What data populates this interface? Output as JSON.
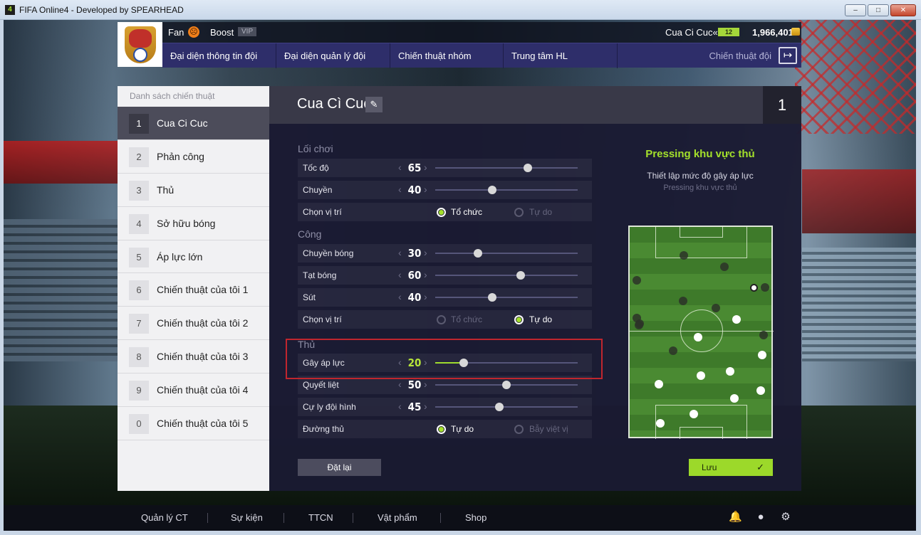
{
  "window": {
    "title": "FIFA Online4 - Developed by SPEARHEAD",
    "app_icon": "4",
    "min_label": "–",
    "max_label": "□",
    "close_label": "✕"
  },
  "header": {
    "fan_label": "Fan",
    "boost_label": "Boost",
    "vip_label": "VIP",
    "user_name": "Cua Ci Cuc«",
    "level": "12",
    "coins": "1,966,401"
  },
  "nav": {
    "items": [
      {
        "label": "Đại diện thông tin đội"
      },
      {
        "label": "Đại diện quản lý đội"
      },
      {
        "label": "Chiến thuật nhóm"
      },
      {
        "label": "Trung tâm HL"
      }
    ],
    "right_label": "Chiến thuật đội",
    "exit_icon": "exit-icon"
  },
  "sidebar": {
    "title": "Danh sách chiến thuật",
    "items": [
      {
        "num": "1",
        "label": "Cua Ci Cuc",
        "active": true
      },
      {
        "num": "2",
        "label": "Phản công"
      },
      {
        "num": "3",
        "label": "Thủ"
      },
      {
        "num": "4",
        "label": "Sở hữu bóng"
      },
      {
        "num": "5",
        "label": "Áp lực lớn"
      },
      {
        "num": "6",
        "label": "Chiến thuật của tôi 1"
      },
      {
        "num": "7",
        "label": "Chiến thuật của tôi 2"
      },
      {
        "num": "8",
        "label": "Chiến thuật của tôi 3"
      },
      {
        "num": "9",
        "label": "Chiến thuật của tôi 4"
      },
      {
        "num": "0",
        "label": "Chiến thuật của tôi 5"
      }
    ]
  },
  "main": {
    "tactic_name": "Cua Cì Cuc",
    "tactic_index": "1",
    "sections": [
      {
        "title": "Lối chơi",
        "rows": [
          {
            "label": "Tốc độ",
            "value": 65
          },
          {
            "label": "Chuyền",
            "value": 40
          },
          {
            "label": "Chọn vị trí",
            "options": [
              "Tổ chức",
              "Tự do"
            ],
            "selected": 0
          }
        ]
      },
      {
        "title": "Công",
        "rows": [
          {
            "label": "Chuyền bóng",
            "value": 30
          },
          {
            "label": "Tạt bóng",
            "value": 60
          },
          {
            "label": "Sút",
            "value": 40
          },
          {
            "label": "Chọn vị trí",
            "options": [
              "Tổ chức",
              "Tự do"
            ],
            "selected": 1
          }
        ]
      },
      {
        "title": "Thủ",
        "rows": [
          {
            "label": "Gây áp lực",
            "value": 20,
            "highlighted": true
          },
          {
            "label": "Quyết liệt",
            "value": 50
          },
          {
            "label": "Cự ly đội hình",
            "value": 45
          },
          {
            "label": "Đường thủ",
            "options": [
              "Tự do",
              "Bẫy việt vị"
            ],
            "selected": 0
          }
        ]
      }
    ],
    "slider_max": 100,
    "reset_label": "Đặt lại",
    "save_label": "Lưu",
    "info_title": "Pressing khu vực thủ",
    "info_desc": "Thiết lập mức độ gây áp lực",
    "info_sub": "Pressing khu vực thủ"
  },
  "bottom": {
    "items": [
      "Quản lý CT",
      "Sự kiện",
      "TTCN",
      "Vật phẩm",
      "Shop"
    ],
    "icons": [
      "bell-icon",
      "user-icon",
      "gear-icon"
    ]
  },
  "colors": {
    "accent": "#a4e02b",
    "highlight_box": "#c0262e",
    "nav_bg": "#2e2e6a"
  }
}
